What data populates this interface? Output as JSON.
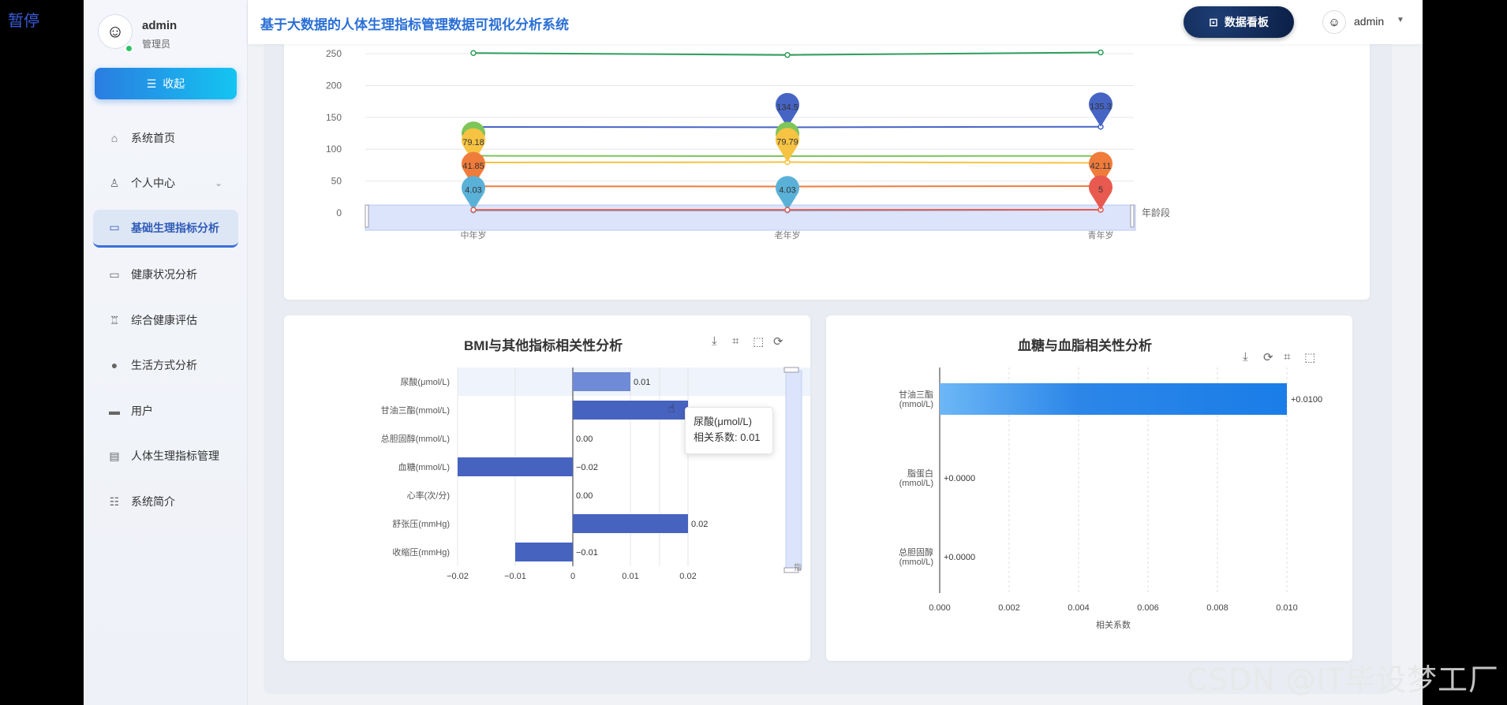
{
  "overlay": {
    "pause_label": "暂停",
    "watermark": "CSDN @IT毕设梦工厂"
  },
  "sidebar": {
    "user": {
      "name": "admin",
      "role": "管理员"
    },
    "collapse_label": "收起",
    "items": [
      {
        "label": "系统首页",
        "icon": "home-icon"
      },
      {
        "label": "个人中心",
        "icon": "user-icon"
      },
      {
        "label": "基础生理指标分析",
        "icon": "chart-board-icon",
        "active": true
      },
      {
        "label": "健康状况分析",
        "icon": "chart-board-icon"
      },
      {
        "label": "综合健康评估",
        "icon": "cup-icon"
      },
      {
        "label": "生活方式分析",
        "icon": "bulb-icon"
      },
      {
        "label": "用户",
        "icon": "briefcase-icon"
      },
      {
        "label": "人体生理指标管理",
        "icon": "clipboard-icon"
      },
      {
        "label": "系统简介",
        "icon": "sliders-icon"
      }
    ]
  },
  "header": {
    "title": "基于大数据的人体生理指标管理数据可视化分析系统",
    "dashboard_label": "数据看板",
    "user": "admin"
  },
  "chart_data": [
    {
      "type": "line",
      "x": [
        "中年岁",
        "老年岁",
        "青年岁"
      ],
      "xlabel": "年龄段",
      "yticks": [
        0,
        50,
        100,
        150,
        200,
        250
      ],
      "ylim": [
        0,
        260
      ],
      "series": [
        {
          "color": "#2e9e5b",
          "values": [
            251,
            248,
            252
          ],
          "pins": []
        },
        {
          "color": "#4664c4",
          "values": [
            135,
            134.5,
            135.3
          ],
          "pins": [
            null,
            "134.5",
            "135.3"
          ]
        },
        {
          "color": "#7ec55a",
          "values": [
            89.69,
            89.13,
            89.5
          ],
          "pins": [
            "89.69",
            "89.13",
            null
          ]
        },
        {
          "color": "#f6c343",
          "values": [
            79.18,
            79.79,
            78.6
          ],
          "pins": [
            "79.18",
            "79.79",
            null
          ]
        },
        {
          "color": "#f07c3c",
          "values": [
            41.85,
            41.5,
            42.11
          ],
          "pins": [
            "41.85",
            null,
            "42.11"
          ]
        },
        {
          "color": "#5ab1d8",
          "values": [
            4.03,
            4.03,
            5
          ],
          "pins": [
            "4.03",
            "4.03",
            null
          ]
        },
        {
          "color": "#e85a4f",
          "values": [
            4.8,
            4.8,
            5
          ],
          "pins": [
            null,
            null,
            "5"
          ]
        }
      ]
    },
    {
      "type": "bar",
      "title": "BMI与其他指标相关性分析",
      "categories": [
        "尿酸(μmol/L)",
        "甘油三酯(mmol/L)",
        "总胆固醇(mmol/L)",
        "血糖(mmol/L)",
        "心率(次/分)",
        "舒张压(mmHg)",
        "收缩压(mmHg)"
      ],
      "values": [
        0.01,
        0.02,
        0.0,
        -0.02,
        0.0,
        0.02,
        -0.01
      ],
      "labels": [
        "0.01",
        "0.02",
        "0.00",
        "−0.02",
        "0.00",
        "0.02",
        "−0.01"
      ],
      "xticks": [
        "−0.02",
        "−0.01",
        "0",
        "0.01",
        "0.02"
      ],
      "xlim": [
        -0.02,
        0.02
      ],
      "tooltip": {
        "title": "尿酸(μmol/L)",
        "text": "相关系数: 0.01"
      },
      "slider_label": "指"
    },
    {
      "type": "bar",
      "title": "血糖与血脂相关性分析",
      "categories": [
        "甘油三酯\n(mmol/L)",
        "脂蛋白\n(mmol/L)",
        "总胆固醇\n(mmol/L)"
      ],
      "values": [
        0.01,
        0.0,
        0.0
      ],
      "labels": [
        "+0.0100",
        "+0.0000",
        "+0.0000"
      ],
      "xticks": [
        "0.000",
        "0.002",
        "0.004",
        "0.006",
        "0.008",
        "0.010"
      ],
      "xlim": [
        0,
        0.01
      ],
      "xlabel": "相关系数"
    }
  ]
}
